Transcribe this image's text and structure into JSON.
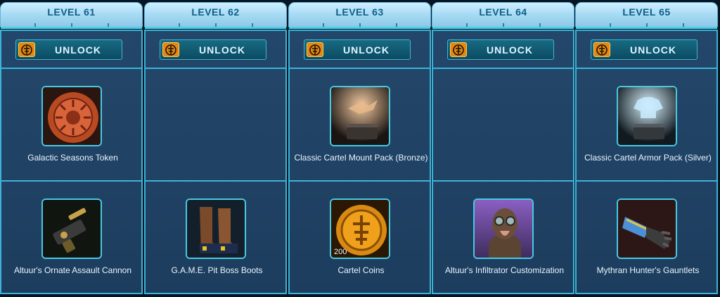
{
  "unlock_label": "UNLOCK",
  "columns": [
    {
      "level": "LEVEL 61",
      "items": [
        {
          "name": "Galactic Seasons Token",
          "icon": "seasons-token-icon"
        },
        {
          "name": "Altuur's Ornate Assault Cannon",
          "icon": "assault-cannon-icon"
        }
      ]
    },
    {
      "level": "LEVEL 62",
      "items": [
        null,
        {
          "name": "G.A.M.E. Pit Boss Boots",
          "icon": "boots-icon"
        }
      ]
    },
    {
      "level": "LEVEL 63",
      "items": [
        {
          "name": "Classic Cartel Mount Pack (Bronze)",
          "icon": "mount-pack-icon"
        },
        {
          "name": "Cartel Coins",
          "icon": "cartel-coins-icon",
          "qty": "200"
        }
      ]
    },
    {
      "level": "LEVEL 64",
      "items": [
        null,
        {
          "name": "Altuur's Infiltrator Customization",
          "icon": "infiltrator-customization-icon"
        }
      ]
    },
    {
      "level": "LEVEL 65",
      "items": [
        {
          "name": "Classic Cartel Armor Pack (Silver)",
          "icon": "armor-pack-icon"
        },
        {
          "name": "Mythran Hunter's Gauntlets",
          "icon": "gauntlets-icon"
        }
      ]
    }
  ]
}
